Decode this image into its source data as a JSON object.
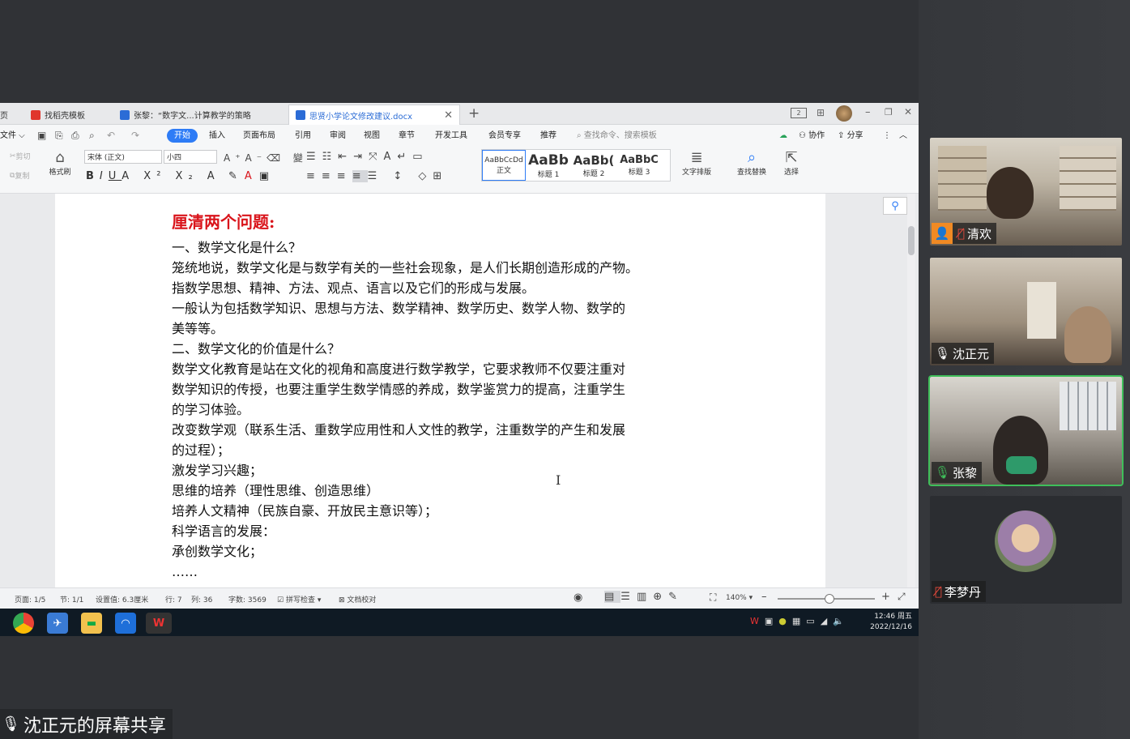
{
  "tabs": [
    {
      "label": "找稻壳模板",
      "color": "#e0362c"
    },
    {
      "label": "张黎：“数字文...计算教学的策略",
      "color": "#2b6cd6"
    },
    {
      "label": "思贤小学论文修改建议.docx",
      "color": "#2b6cd6"
    }
  ],
  "tab_left_stub": "页",
  "menu": {
    "file": "文件",
    "items": [
      "开始",
      "插入",
      "页面布局",
      "引用",
      "审阅",
      "视图",
      "章节",
      "开发工具",
      "会员专享",
      "推荐"
    ],
    "search_placeholder": "查找命令、搜索模板",
    "collab": "协作",
    "share": "分享"
  },
  "ribbon": {
    "cut": "剪切",
    "copy": "复制",
    "format_painter": "格式刷",
    "font_name": "宋体 (正文)",
    "font_size": "小四",
    "styles": [
      {
        "preview": "AaBbCcDd",
        "label": "正文"
      },
      {
        "preview": "AaBb",
        "label": "标题 1"
      },
      {
        "preview": "AaBb(",
        "label": "标题 2"
      },
      {
        "preview": "AaBbC",
        "label": "标题 3"
      }
    ],
    "text_layout": "文字排版",
    "find_replace": "查找替换",
    "select": "选择"
  },
  "document": {
    "heading": "厘清两个问题:",
    "lines": [
      "一、数学文化是什么？",
      "笼统地说，数学文化是与数学有关的一些社会现象，是人们长期创造形成的产物。",
      "指数学思想、精神、方法、观点、语言以及它们的形成与发展。",
      "一般认为包括数学知识、思想与方法、数学精神、数学历史、数学人物、数学的",
      "美等等。",
      "二、数学文化的价值是什么？",
      "数学文化教育是站在文化的视角和高度进行数学教学，它要求教师不仅要注重对",
      "数学知识的传授，也要注重学生数学情感的养成，数学鉴赏力的提高，注重学生",
      "的学习体验。",
      "改变数学观（联系生活、重数学应用性和人文性的教学，注重数学的产生和发展",
      "的过程）；",
      "激发学习兴趣；",
      "思维的培养（理性思维、创造思维）",
      "培养人文精神（民族自豪、开放民主意识等）；",
      "科学语言的发展：",
      "承创数学文化；",
      "……"
    ]
  },
  "status": {
    "page": "页面: 1/5",
    "section": "节: 1/1",
    "setting": "设置值: 6.3厘米",
    "row": "行: 7",
    "col": "列: 36",
    "words": "字数: 3569",
    "spell": "拼写检查",
    "proof": "文档校对",
    "zoom": "140%"
  },
  "taskbar": {
    "time": "12:46 周五",
    "date": "2022/12/16"
  },
  "share_label": "沈正元的屏幕共享",
  "participants": [
    {
      "name": "清欢",
      "muted": true
    },
    {
      "name": "沈正元",
      "muted": false
    },
    {
      "name": "张黎",
      "muted": false
    },
    {
      "name": "李梦丹",
      "muted": true
    }
  ],
  "colors": {
    "accent": "#2e7cf6",
    "heading_red": "#d9141b",
    "active_speaker": "#3fbf5a"
  }
}
